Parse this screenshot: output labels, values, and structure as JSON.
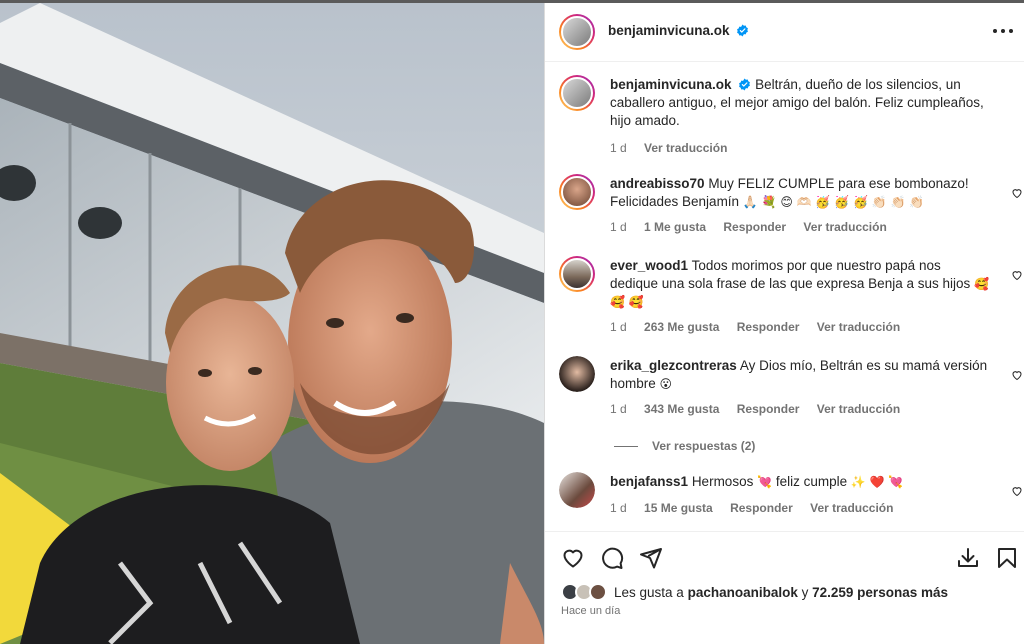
{
  "post": {
    "author": "benjaminvicuna.ok",
    "more_icon": "more-horizontal-icon",
    "photo_alt": "selfie of father and son"
  },
  "caption": {
    "username": "benjaminvicuna.ok",
    "text": "Beltrán, dueño de los silencios, un caballero antiguo, el mejor amigo del balón. Feliz cumpleaños, hijo amado.",
    "age": "1 d",
    "translate": "Ver traducción"
  },
  "comments": [
    {
      "username": "andreabisso70",
      "text": "Muy FELIZ CUMPLE para ese bombonazo! Felicidades Benjamín",
      "emojis": "🙏🏻 💐 😊 🫶🏻 🥳 🥳 🥳 👏🏻 👏🏻 👏🏻",
      "age": "1 d",
      "likes": "1 Me gusta",
      "reply": "Responder",
      "translate": "Ver traducción"
    },
    {
      "username": "ever_wood1",
      "text": "Todos morimos por que nuestro papá nos dedique una sola frase de las que expresa Benja a sus hijos",
      "emojis": "🥰 🥰 🥰",
      "age": "1 d",
      "likes": "263 Me gusta",
      "reply": "Responder",
      "translate": "Ver traducción"
    },
    {
      "username": "erika_glezcontreras",
      "text": "Ay Dios mío, Beltrán es su mamá versión hombre",
      "emojis": "😮",
      "age": "1 d",
      "likes": "343 Me gusta",
      "reply": "Responder",
      "translate": "Ver traducción"
    },
    {
      "username": "benjafanss1",
      "text": "Hermosos",
      "emojis_a": "💘",
      "text_b": "feliz cumple",
      "emojis_b": "✨ ❤️ 💘",
      "age": "1 d",
      "likes": "15 Me gusta",
      "reply": "Responder",
      "translate": "Ver traducción"
    }
  ],
  "view_replies": "Ver respuestas (2)",
  "likes": {
    "prefix": "Les gusta a",
    "user": "pachanoanibalok",
    "middle": "y",
    "count": "72.259 personas más"
  },
  "posted": "Hace un día",
  "icons": {
    "like": "heart-icon",
    "comment": "comment-icon",
    "share": "share-icon",
    "download": "download-icon",
    "save": "bookmark-icon"
  },
  "colors": {
    "verified": "#0095f6",
    "meta": "#737373",
    "text": "#262626"
  }
}
